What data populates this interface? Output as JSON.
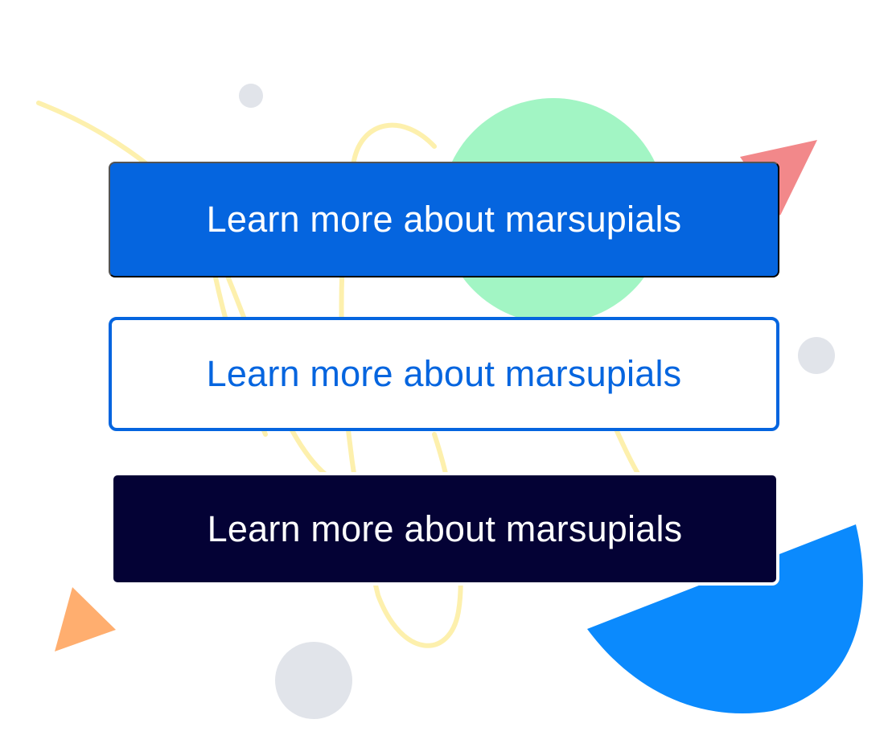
{
  "buttons": {
    "primary_label": "Learn more about marsupials",
    "secondary_label": "Learn more about marsupials",
    "dark_label": "Learn more about marsupials"
  },
  "colors": {
    "primary": "#0565df",
    "dark": "#040235",
    "background": "#ffffff",
    "decor_yellow": "#fdf0ad",
    "decor_green": "#a2f5c4",
    "decor_gray": "#e1e4ea",
    "decor_red": "#f2888a",
    "decor_orange": "#ffae6f",
    "decor_blue": "#0b8afd"
  }
}
